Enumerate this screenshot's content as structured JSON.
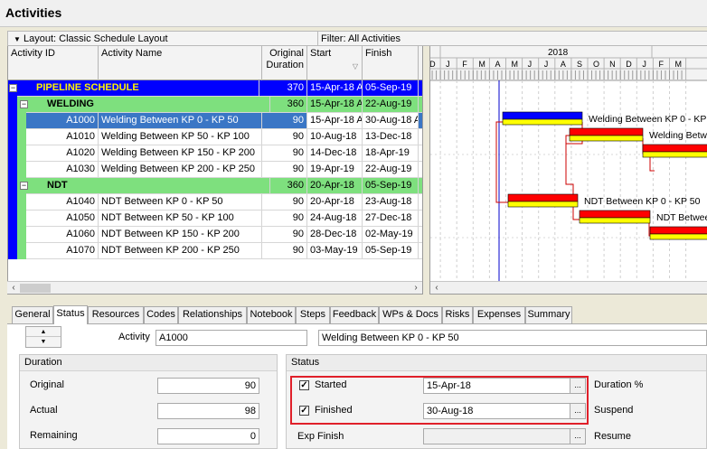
{
  "window": {
    "title": "Activities"
  },
  "toolbar": {
    "layout": "Layout: Classic Schedule Layout",
    "filter": "Filter: All Activities"
  },
  "columns": {
    "activity_id": "Activity ID",
    "activity_name": "Activity Name",
    "duration_line1": "Original",
    "duration_line2": "Duration",
    "start": "Start",
    "finish": "Finish"
  },
  "rows": [
    {
      "id": "",
      "name": "PIPELINE SCHEDULE",
      "dur": "370",
      "start": "15-Apr-18 A",
      "finish": "05-Sep-19"
    },
    {
      "id": "",
      "name": "WELDING",
      "dur": "360",
      "start": "15-Apr-18 A",
      "finish": "22-Aug-19"
    },
    {
      "id": "A1000",
      "name": "Welding Between KP 0 - KP 50",
      "dur": "90",
      "start": "15-Apr-18 A",
      "finish": "30-Aug-18 A"
    },
    {
      "id": "A1010",
      "name": "Welding Between KP 50 - KP 100",
      "dur": "90",
      "start": "10-Aug-18",
      "finish": "13-Dec-18"
    },
    {
      "id": "A1020",
      "name": "Welding Between KP 150 - KP 200",
      "dur": "90",
      "start": "14-Dec-18",
      "finish": "18-Apr-19"
    },
    {
      "id": "A1030",
      "name": "Welding Between  KP 200 - KP 250",
      "dur": "90",
      "start": "19-Apr-19",
      "finish": "22-Aug-19"
    },
    {
      "id": "",
      "name": "NDT",
      "dur": "360",
      "start": "20-Apr-18",
      "finish": "05-Sep-19"
    },
    {
      "id": "A1040",
      "name": "NDT Between KP 0 - KP 50",
      "dur": "90",
      "start": "20-Apr-18",
      "finish": "23-Aug-18"
    },
    {
      "id": "A1050",
      "name": "NDT Between KP 50 - KP 100",
      "dur": "90",
      "start": "24-Aug-18",
      "finish": "27-Dec-18"
    },
    {
      "id": "A1060",
      "name": "NDT Between KP 150 - KP 200",
      "dur": "90",
      "start": "28-Dec-18",
      "finish": "02-May-19"
    },
    {
      "id": "A1070",
      "name": "NDT Between  KP 200 - KP 250",
      "dur": "90",
      "start": "03-May-19",
      "finish": "05-Sep-19"
    }
  ],
  "gantt": {
    "year_label": "2018",
    "months": [
      "D",
      "J",
      "F",
      "M",
      "A",
      "M",
      "J",
      "J",
      "A",
      "S",
      "O",
      "N",
      "D",
      "J",
      "F",
      "M"
    ],
    "bar_labels": [
      "Welding Between KP 0 - KP 50",
      "Welding Between KP 50 - KP 100",
      "NDT Between KP 0 - KP 50",
      "NDT Between KP 50 - KP 100"
    ],
    "colors": {
      "actual": "#0000ff",
      "remaining": "#ff0000",
      "baseline": "#ffff00",
      "data_date": "#0000cc",
      "relationship": "#cc0000"
    }
  },
  "tabs": [
    "General",
    "Status",
    "Resources",
    "Codes",
    "Relationships",
    "Notebook",
    "Steps",
    "Feedback",
    "WPs & Docs",
    "Risks",
    "Expenses",
    "Summary"
  ],
  "active_tab": "Status",
  "detail": {
    "activity_label": "Activity",
    "activity_id": "A1000",
    "activity_name": "Welding Between KP 0 - KP 50",
    "duration": {
      "title": "Duration",
      "original_label": "Original",
      "original": "90",
      "actual_label": "Actual",
      "actual": "98",
      "remaining_label": "Remaining",
      "remaining": "0"
    },
    "status": {
      "title": "Status",
      "started_label": "Started",
      "started": "15-Apr-18",
      "finished_label": "Finished",
      "finished": "30-Aug-18",
      "exp_finish_label": "Exp Finish",
      "exp_finish": "",
      "duration_pct_label": "Duration %",
      "suspend_label": "Suspend",
      "resume_label": "Resume"
    }
  }
}
